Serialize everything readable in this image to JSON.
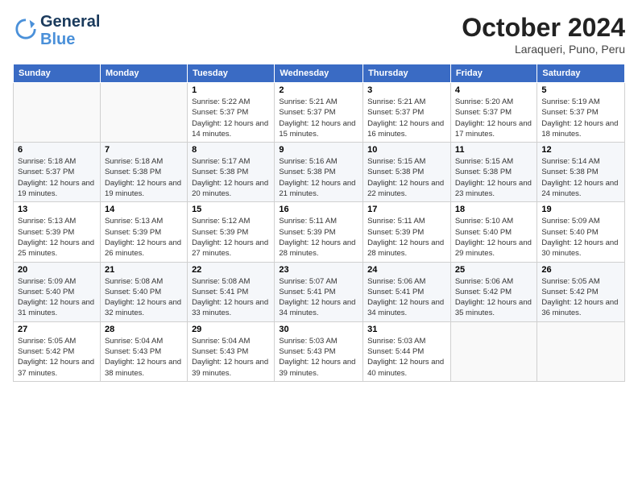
{
  "logo": {
    "line1": "General",
    "line2": "Blue"
  },
  "header": {
    "title": "October 2024",
    "subtitle": "Laraqueri, Puno, Peru"
  },
  "weekdays": [
    "Sunday",
    "Monday",
    "Tuesday",
    "Wednesday",
    "Thursday",
    "Friday",
    "Saturday"
  ],
  "weeks": [
    [
      {
        "day": "",
        "sunrise": "",
        "sunset": "",
        "daylight": ""
      },
      {
        "day": "",
        "sunrise": "",
        "sunset": "",
        "daylight": ""
      },
      {
        "day": "1",
        "sunrise": "Sunrise: 5:22 AM",
        "sunset": "Sunset: 5:37 PM",
        "daylight": "Daylight: 12 hours and 14 minutes."
      },
      {
        "day": "2",
        "sunrise": "Sunrise: 5:21 AM",
        "sunset": "Sunset: 5:37 PM",
        "daylight": "Daylight: 12 hours and 15 minutes."
      },
      {
        "day": "3",
        "sunrise": "Sunrise: 5:21 AM",
        "sunset": "Sunset: 5:37 PM",
        "daylight": "Daylight: 12 hours and 16 minutes."
      },
      {
        "day": "4",
        "sunrise": "Sunrise: 5:20 AM",
        "sunset": "Sunset: 5:37 PM",
        "daylight": "Daylight: 12 hours and 17 minutes."
      },
      {
        "day": "5",
        "sunrise": "Sunrise: 5:19 AM",
        "sunset": "Sunset: 5:37 PM",
        "daylight": "Daylight: 12 hours and 18 minutes."
      }
    ],
    [
      {
        "day": "6",
        "sunrise": "Sunrise: 5:18 AM",
        "sunset": "Sunset: 5:37 PM",
        "daylight": "Daylight: 12 hours and 19 minutes."
      },
      {
        "day": "7",
        "sunrise": "Sunrise: 5:18 AM",
        "sunset": "Sunset: 5:38 PM",
        "daylight": "Daylight: 12 hours and 19 minutes."
      },
      {
        "day": "8",
        "sunrise": "Sunrise: 5:17 AM",
        "sunset": "Sunset: 5:38 PM",
        "daylight": "Daylight: 12 hours and 20 minutes."
      },
      {
        "day": "9",
        "sunrise": "Sunrise: 5:16 AM",
        "sunset": "Sunset: 5:38 PM",
        "daylight": "Daylight: 12 hours and 21 minutes."
      },
      {
        "day": "10",
        "sunrise": "Sunrise: 5:15 AM",
        "sunset": "Sunset: 5:38 PM",
        "daylight": "Daylight: 12 hours and 22 minutes."
      },
      {
        "day": "11",
        "sunrise": "Sunrise: 5:15 AM",
        "sunset": "Sunset: 5:38 PM",
        "daylight": "Daylight: 12 hours and 23 minutes."
      },
      {
        "day": "12",
        "sunrise": "Sunrise: 5:14 AM",
        "sunset": "Sunset: 5:38 PM",
        "daylight": "Daylight: 12 hours and 24 minutes."
      }
    ],
    [
      {
        "day": "13",
        "sunrise": "Sunrise: 5:13 AM",
        "sunset": "Sunset: 5:39 PM",
        "daylight": "Daylight: 12 hours and 25 minutes."
      },
      {
        "day": "14",
        "sunrise": "Sunrise: 5:13 AM",
        "sunset": "Sunset: 5:39 PM",
        "daylight": "Daylight: 12 hours and 26 minutes."
      },
      {
        "day": "15",
        "sunrise": "Sunrise: 5:12 AM",
        "sunset": "Sunset: 5:39 PM",
        "daylight": "Daylight: 12 hours and 27 minutes."
      },
      {
        "day": "16",
        "sunrise": "Sunrise: 5:11 AM",
        "sunset": "Sunset: 5:39 PM",
        "daylight": "Daylight: 12 hours and 28 minutes."
      },
      {
        "day": "17",
        "sunrise": "Sunrise: 5:11 AM",
        "sunset": "Sunset: 5:39 PM",
        "daylight": "Daylight: 12 hours and 28 minutes."
      },
      {
        "day": "18",
        "sunrise": "Sunrise: 5:10 AM",
        "sunset": "Sunset: 5:40 PM",
        "daylight": "Daylight: 12 hours and 29 minutes."
      },
      {
        "day": "19",
        "sunrise": "Sunrise: 5:09 AM",
        "sunset": "Sunset: 5:40 PM",
        "daylight": "Daylight: 12 hours and 30 minutes."
      }
    ],
    [
      {
        "day": "20",
        "sunrise": "Sunrise: 5:09 AM",
        "sunset": "Sunset: 5:40 PM",
        "daylight": "Daylight: 12 hours and 31 minutes."
      },
      {
        "day": "21",
        "sunrise": "Sunrise: 5:08 AM",
        "sunset": "Sunset: 5:40 PM",
        "daylight": "Daylight: 12 hours and 32 minutes."
      },
      {
        "day": "22",
        "sunrise": "Sunrise: 5:08 AM",
        "sunset": "Sunset: 5:41 PM",
        "daylight": "Daylight: 12 hours and 33 minutes."
      },
      {
        "day": "23",
        "sunrise": "Sunrise: 5:07 AM",
        "sunset": "Sunset: 5:41 PM",
        "daylight": "Daylight: 12 hours and 34 minutes."
      },
      {
        "day": "24",
        "sunrise": "Sunrise: 5:06 AM",
        "sunset": "Sunset: 5:41 PM",
        "daylight": "Daylight: 12 hours and 34 minutes."
      },
      {
        "day": "25",
        "sunrise": "Sunrise: 5:06 AM",
        "sunset": "Sunset: 5:42 PM",
        "daylight": "Daylight: 12 hours and 35 minutes."
      },
      {
        "day": "26",
        "sunrise": "Sunrise: 5:05 AM",
        "sunset": "Sunset: 5:42 PM",
        "daylight": "Daylight: 12 hours and 36 minutes."
      }
    ],
    [
      {
        "day": "27",
        "sunrise": "Sunrise: 5:05 AM",
        "sunset": "Sunset: 5:42 PM",
        "daylight": "Daylight: 12 hours and 37 minutes."
      },
      {
        "day": "28",
        "sunrise": "Sunrise: 5:04 AM",
        "sunset": "Sunset: 5:43 PM",
        "daylight": "Daylight: 12 hours and 38 minutes."
      },
      {
        "day": "29",
        "sunrise": "Sunrise: 5:04 AM",
        "sunset": "Sunset: 5:43 PM",
        "daylight": "Daylight: 12 hours and 39 minutes."
      },
      {
        "day": "30",
        "sunrise": "Sunrise: 5:03 AM",
        "sunset": "Sunset: 5:43 PM",
        "daylight": "Daylight: 12 hours and 39 minutes."
      },
      {
        "day": "31",
        "sunrise": "Sunrise: 5:03 AM",
        "sunset": "Sunset: 5:44 PM",
        "daylight": "Daylight: 12 hours and 40 minutes."
      },
      {
        "day": "",
        "sunrise": "",
        "sunset": "",
        "daylight": ""
      },
      {
        "day": "",
        "sunrise": "",
        "sunset": "",
        "daylight": ""
      }
    ]
  ]
}
